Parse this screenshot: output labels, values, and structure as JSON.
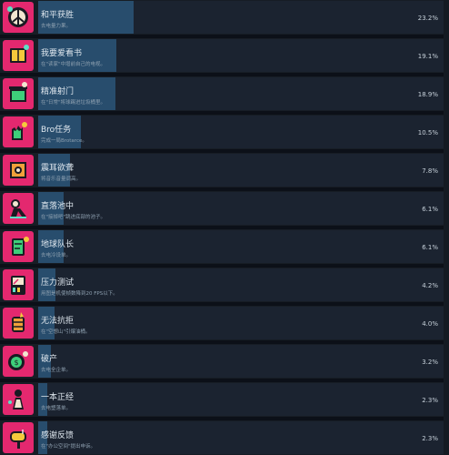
{
  "theme": {
    "icon_bg": "#e4286f",
    "bar": "#284d6d",
    "row_bg": "#171d25"
  },
  "achievements": [
    {
      "title": "和平获胜",
      "desc": "去电量力果。",
      "percent_label": "23.2%",
      "percent": 23.2,
      "icon": "peace-badge-icon"
    },
    {
      "title": "我要爱看书",
      "desc": "在\"读家\"中增前自己的电视。",
      "percent_label": "19.1%",
      "percent": 19.1,
      "icon": "book-icon"
    },
    {
      "title": "精准射门",
      "desc": "在\"日常\"将球踢进垃圾桶里。",
      "percent_label": "18.9%",
      "percent": 18.9,
      "icon": "trash-can-icon"
    },
    {
      "title": "Bro任务",
      "desc": "完成一局Brotarce。",
      "percent_label": "10.5%",
      "percent": 10.5,
      "icon": "hand-sign-icon"
    },
    {
      "title": "震耳欲聋",
      "desc": "将音乐音量调高。",
      "percent_label": "7.8%",
      "percent": 7.8,
      "icon": "speaker-icon"
    },
    {
      "title": "直落池中",
      "desc": "在\"接掉吧\"跳进底部的池子。",
      "percent_label": "6.1%",
      "percent": 6.1,
      "icon": "diver-icon"
    },
    {
      "title": "地球队长",
      "desc": "去电冷设单。",
      "percent_label": "6.1%",
      "percent": 6.1,
      "icon": "earth-can-icon"
    },
    {
      "title": "压力测试",
      "desc": "用图是机使帧数降到20 FPS以下。",
      "percent_label": "4.2%",
      "percent": 4.2,
      "icon": "meter-icon"
    },
    {
      "title": "无法抗拒",
      "desc": "在\"空想山\"引爆油桶。",
      "percent_label": "4.0%",
      "percent": 4.0,
      "icon": "barrel-icon"
    },
    {
      "title": "破产",
      "desc": "去电全企单。",
      "percent_label": "3.2%",
      "percent": 3.2,
      "icon": "money-icon"
    },
    {
      "title": "一本正经",
      "desc": "去电塑落单。",
      "percent_label": "2.3%",
      "percent": 2.3,
      "icon": "figure-icon"
    },
    {
      "title": "感谢反馈",
      "desc": "在\"办公空间\"提出申诉。",
      "percent_label": "2.3%",
      "percent": 2.3,
      "icon": "mailbox-icon"
    }
  ]
}
